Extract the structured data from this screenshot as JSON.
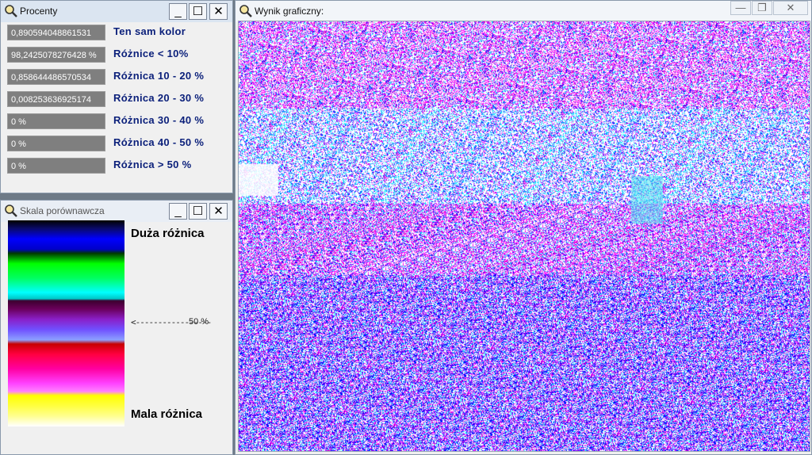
{
  "procenty": {
    "title": "Procenty",
    "rows": [
      {
        "value": "0,890594048861531",
        "label": "Ten sam kolor"
      },
      {
        "value": "98,2425078276428 %",
        "label": "Różnice < 10%"
      },
      {
        "value": "0,858644486570534",
        "label": "Różnica 10 - 20  %"
      },
      {
        "value": "0,008253636925174",
        "label": "Różnica 20 - 30  %"
      },
      {
        "value": "0 %",
        "label": "Różnica 30 - 40  %"
      },
      {
        "value": "0 %",
        "label": "Różnica 40 - 50  %"
      },
      {
        "value": "0 %",
        "label": "Różnica > 50 %"
      }
    ]
  },
  "skala": {
    "title": "Skala porównawcza",
    "top_label": "Duża różnica",
    "bottom_label": "Mala różnica",
    "arrow": "<-----------------",
    "arrow_value": "50 %"
  },
  "wynik": {
    "title": "Wynik graficzny:"
  },
  "controls": {
    "minimize": "_",
    "maximize": "☐",
    "close": "✕"
  },
  "colors": {
    "noise_palette": [
      "#ff00ff",
      "#e000c0",
      "#0000ff",
      "#3c3cff",
      "#00c8ff",
      "#00ffff",
      "#7a2cff",
      "#ff40ff"
    ],
    "title_text": "#0a1f7a",
    "field_bg": "#7f7f7f"
  }
}
